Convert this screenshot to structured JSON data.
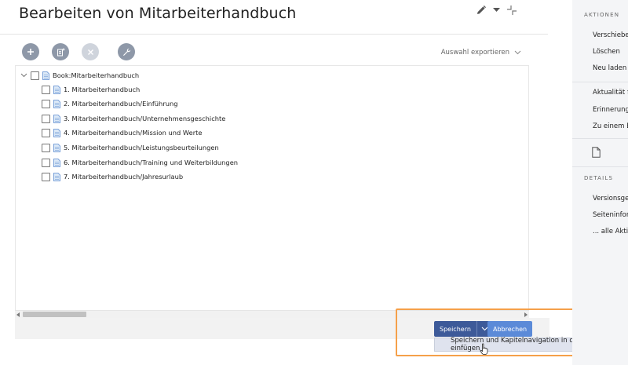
{
  "title": "Bearbeiten von Mitarbeiterhandbuch",
  "toolbar": {
    "export_label": "Auswahl exportieren"
  },
  "tree": {
    "root": "Book:Mitarbeiterhandbuch",
    "items": [
      "1. Mitarbeiterhandbuch",
      "2. Mitarbeiterhandbuch/Einführung",
      "3. Mitarbeiterhandbuch/Unternehmensgeschichte",
      "4. Mitarbeiterhandbuch/Mission und Werte",
      "5. Mitarbeiterhandbuch/Leistungsbeurteilungen",
      "6. Mitarbeiterhandbuch/Training und Weiterbildungen",
      "7. Mitarbeiterhandbuch/Jahresurlaub"
    ]
  },
  "buttons": {
    "save": "Speichern",
    "cancel": "Abbrechen",
    "save_option": "Speichern und Kapitelnavigation in die Seiten einfügen"
  },
  "sidebar": {
    "actions_heading": "AKTIONEN",
    "actions": [
      "Verschieben",
      "Löschen",
      "Neu laden",
      "Aktualität f",
      "Erinnerung",
      "Zu einem B"
    ],
    "details_heading": "DETAILS",
    "details": [
      "Versionsges",
      "Seiteninforr",
      "... alle Aktio"
    ]
  },
  "colors": {
    "primary": "#3d5a99",
    "secondary": "#5b8ad8",
    "highlight": "#f5a04a"
  }
}
